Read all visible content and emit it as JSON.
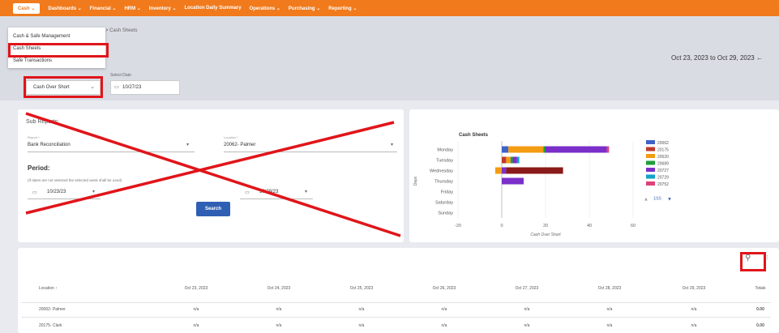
{
  "nav": {
    "items": [
      "Cash ⌄",
      "Dashboards ⌄",
      "Financial ⌄",
      "HRM ⌄",
      "Inventory ⌄",
      "Location Daily Summary",
      "Operations ⌄",
      "Purchasing ⌄",
      "Reporting ⌄"
    ]
  },
  "breadcrumb": "> Cash Sheets",
  "cash_menu": [
    "Cash & Safe Management",
    "Cash Sheets",
    "Safe Transactions"
  ],
  "date_range": "Oct 23, 2023 to Oct 29, 2023 ←",
  "filters": {
    "report_value": "Cash Over Short",
    "date_label": "Select Date",
    "date_value": "10/27/23"
  },
  "form": {
    "section_title": "Sub Reports:",
    "report_label": "Report *",
    "report_value": "Bank Reconciliation",
    "location_label": "Location *",
    "location_value": "20062- Palmer",
    "period_title": "Period:",
    "period_note": "(If dates are not selected the selected week shall be used)",
    "start_date": "10/23/23",
    "end_date": "10/29/23",
    "search_label": "Search"
  },
  "chart_data": {
    "type": "bar",
    "orientation": "horizontal",
    "stacked": true,
    "title": "Cash Sheets",
    "xlabel": "Cash Over Short",
    "ylabel": "Days",
    "xlim": [
      -20,
      60
    ],
    "xticks": [
      "-20",
      "0",
      "20",
      "40",
      "60"
    ],
    "categories": [
      "Monday",
      "Tuesday",
      "Wednesday",
      "Thursday",
      "Friday",
      "Saturday",
      "Sunday"
    ],
    "series": [
      {
        "name": "20062",
        "color": "#3f62c9",
        "values": [
          3,
          0,
          0,
          0,
          0,
          0,
          0
        ]
      },
      {
        "name": "20175",
        "color": "#c0392b",
        "values": [
          0,
          2,
          0,
          0,
          0,
          0,
          0
        ]
      },
      {
        "name": "20520",
        "color": "#f39c12",
        "values": [
          16,
          2,
          -3,
          0,
          0,
          0,
          0
        ]
      },
      {
        "name": "20689",
        "color": "#1e9e3a",
        "values": [
          1,
          1,
          0,
          0,
          0,
          0,
          0
        ]
      },
      {
        "name": "20727",
        "color": "#7b2fc9",
        "values": [
          28,
          2,
          2,
          10,
          0,
          0,
          0
        ]
      },
      {
        "name": "20729",
        "color": "#12a3c9",
        "values": [
          0,
          1,
          0,
          0,
          0,
          0,
          0
        ]
      },
      {
        "name": "20752",
        "color": "#e0407a",
        "values": [
          1,
          0,
          0,
          0,
          0,
          0,
          0
        ]
      },
      {
        "name": "",
        "color": "#8b1a1a",
        "values": [
          0,
          0,
          26,
          0,
          0,
          0,
          0
        ]
      }
    ],
    "legend_page": "1/15",
    "legend_position": "right"
  },
  "table": {
    "headers": [
      "Location ↑",
      "Oct 23, 2023",
      "Oct 24, 2023",
      "Oct 25, 2023",
      "Oct 26, 2023",
      "Oct 27, 2023",
      "Oct 28, 2023",
      "Oct 29, 2023",
      "Totals"
    ],
    "rows": [
      [
        "20062- Palmer",
        "n/a",
        "n/a",
        "n/a",
        "n/a",
        "n/a",
        "n/a",
        "n/a",
        "0.00"
      ],
      [
        "20175- Clark",
        "n/a",
        "n/a",
        "n/a",
        "n/a",
        "n/a",
        "n/a",
        "n/a",
        "0.00"
      ]
    ]
  },
  "colors": {
    "accent": "#f07a1c",
    "button": "#2f5fb3",
    "annotation": "#e0151a"
  }
}
